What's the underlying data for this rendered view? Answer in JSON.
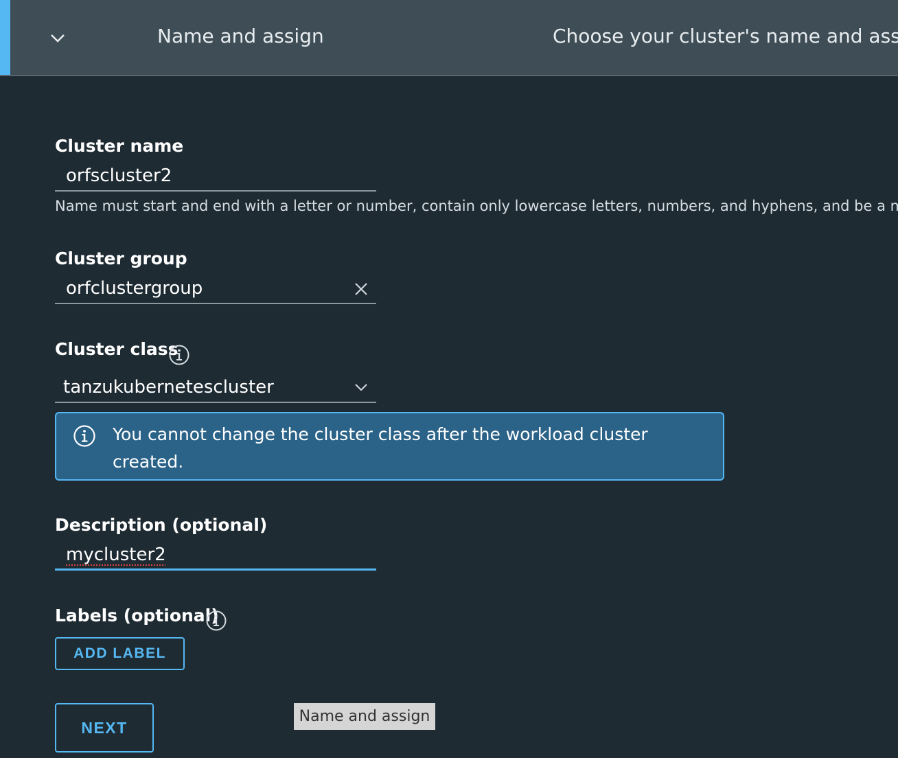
{
  "step": {
    "title": "Name and assign",
    "description": "Choose your cluster's name and assign"
  },
  "cluster_name": {
    "label": "Cluster name",
    "value": "orfscluster2",
    "helper": "Name must start and end with a letter or number, contain only lowercase letters, numbers, and hyphens, and be a max"
  },
  "cluster_group": {
    "label": "Cluster group",
    "value": "orfclustergroup"
  },
  "cluster_class": {
    "label": "Cluster class",
    "value": "tanzukubernetescluster"
  },
  "alert": {
    "text": "You cannot change the cluster class after the workload cluster created."
  },
  "description": {
    "label": "Description (optional)",
    "value": "mycluster2"
  },
  "labels": {
    "label": "Labels (optional)",
    "add_button": "ADD LABEL"
  },
  "next_button": "NEXT",
  "tooltip": "Name and assign",
  "colors": {
    "accent": "#56b8f3",
    "background": "#1f2b33",
    "header": "#3f4d56",
    "alert_bg": "#2b6287"
  }
}
